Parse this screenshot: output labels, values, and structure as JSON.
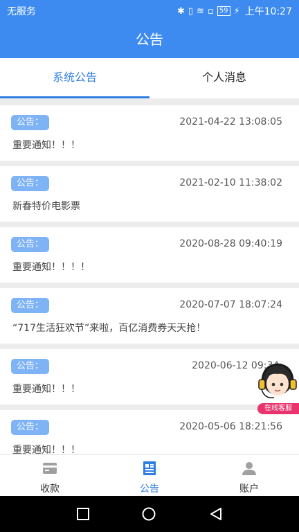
{
  "status": {
    "carrier": "无服务",
    "battery": "59",
    "time": "上午10:27"
  },
  "header": {
    "title": "公告"
  },
  "tabs": [
    {
      "label": "系统公告",
      "active": true
    },
    {
      "label": "个人消息",
      "active": false
    }
  ],
  "notices": [
    {
      "badge": "公告：",
      "date": "2021-04-22 13:08:05",
      "content": "重要通知！！！"
    },
    {
      "badge": "公告：",
      "date": "2021-02-10 11:38:02",
      "content": "新春特价电影票"
    },
    {
      "badge": "公告：",
      "date": "2020-08-28 09:40:19",
      "content": "重要通知！！！！"
    },
    {
      "badge": "公告：",
      "date": "2020-07-07 18:07:24",
      "content": "“717生活狂欢节”来啦，百亿消费券天天抢！"
    },
    {
      "badge": "公告：",
      "date": "2020-06-12 09:34:",
      "content": "重要通知！！！"
    },
    {
      "badge": "公告：",
      "date": "2020-05-06 18:21:56",
      "content": "重要通知！！！"
    }
  ],
  "support": {
    "label": "在线客服"
  },
  "nav": [
    {
      "label": "收款",
      "icon": "card-icon",
      "active": false
    },
    {
      "label": "公告",
      "icon": "notice-icon",
      "active": true
    },
    {
      "label": "账户",
      "icon": "user-icon",
      "active": false
    }
  ],
  "colors": {
    "primary": "#3d8bf0",
    "accent": "#2f7fe3",
    "badge": "#7eb3f5",
    "support": "#e8336d"
  }
}
